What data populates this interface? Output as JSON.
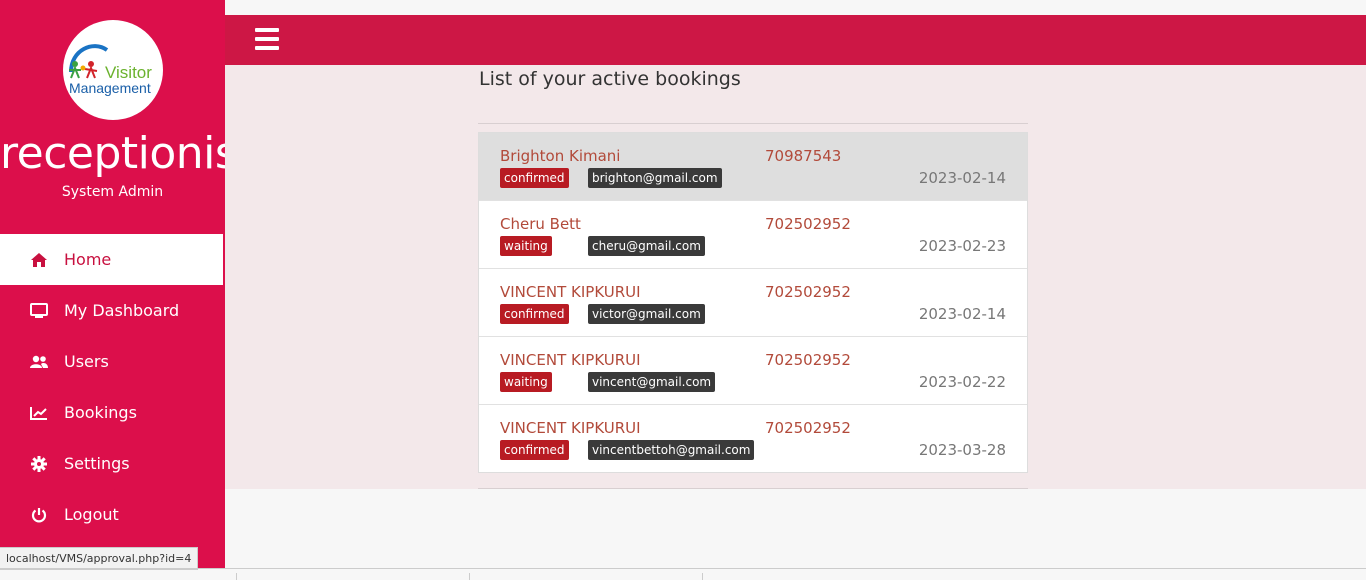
{
  "sidebar": {
    "logo": {
      "line1": "Visitor",
      "line2": "Management"
    },
    "role": "receptionist",
    "subrole": "System Admin",
    "items": [
      {
        "label": "Home",
        "icon": "home-icon",
        "active": true
      },
      {
        "label": "My Dashboard",
        "icon": "monitor-icon"
      },
      {
        "label": "Users",
        "icon": "users-icon"
      },
      {
        "label": "Bookings",
        "icon": "chart-icon"
      },
      {
        "label": "Settings",
        "icon": "gear-icon"
      },
      {
        "label": "Logout",
        "icon": "power-icon"
      }
    ]
  },
  "header": {
    "menu_icon": "hamburger-icon"
  },
  "main": {
    "heading": "List of your active bookings",
    "bookings": [
      {
        "name": "Brighton Kimani",
        "phone": "70987543",
        "status": "confirmed",
        "email": "brighton@gmail.com",
        "date": "2023-02-14"
      },
      {
        "name": "Cheru Bett",
        "phone": "702502952",
        "status": "waiting",
        "email": "cheru@gmail.com",
        "date": "2023-02-23"
      },
      {
        "name": "VINCENT KIPKURUI",
        "phone": "702502952",
        "status": "confirmed",
        "email": "victor@gmail.com",
        "date": "2023-02-14"
      },
      {
        "name": "VINCENT KIPKURUI",
        "phone": "702502952",
        "status": "waiting",
        "email": "vincent@gmail.com",
        "date": "2023-02-22"
      },
      {
        "name": "VINCENT KIPKURUI",
        "phone": "702502952",
        "status": "confirmed",
        "email": "vincentbettoh@gmail.com",
        "date": "2023-03-28"
      }
    ]
  },
  "statusbar": {
    "url": "localhost/VMS/approval.php?id=4"
  },
  "colors": {
    "sidebar": "#dc0f4b",
    "topbar": "#cd1745",
    "content_bg": "#f3e8ea",
    "status_badge": "#b81b23",
    "email_badge": "#3a3a3a"
  }
}
